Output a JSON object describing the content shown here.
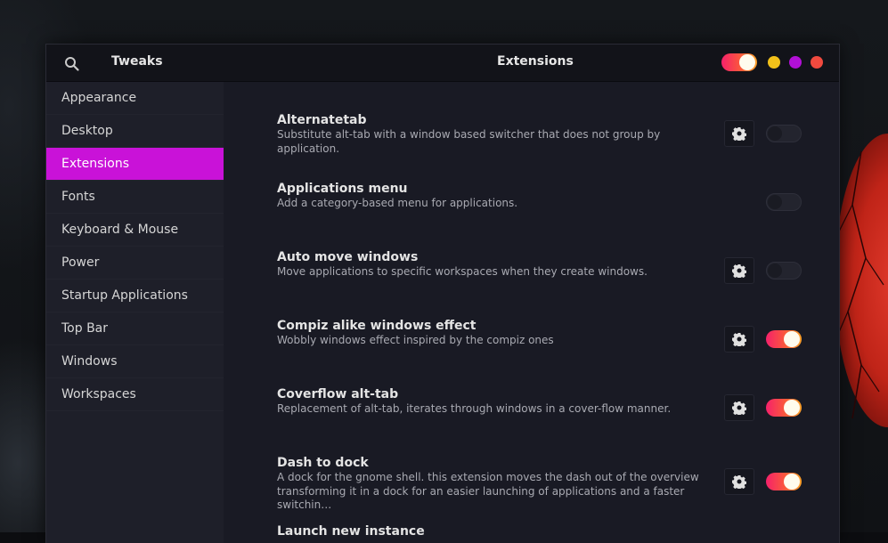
{
  "app": {
    "title": "Tweaks",
    "page_title": "Extensions"
  },
  "headerbar": {
    "search_icon": "search-icon",
    "window_controls": [
      {
        "name": "minimize",
        "color": "#f2c11a"
      },
      {
        "name": "maximize",
        "color": "#b210d6"
      },
      {
        "name": "close",
        "color": "#f14a3f"
      }
    ],
    "global_toggle": "on"
  },
  "sidebar": {
    "items": [
      {
        "label": "Appearance"
      },
      {
        "label": "Desktop"
      },
      {
        "label": "Extensions",
        "active": true
      },
      {
        "label": "Fonts"
      },
      {
        "label": "Keyboard & Mouse"
      },
      {
        "label": "Power"
      },
      {
        "label": "Startup Applications"
      },
      {
        "label": "Top Bar"
      },
      {
        "label": "Windows"
      },
      {
        "label": "Workspaces"
      }
    ]
  },
  "extensions": [
    {
      "name": "Alternatetab",
      "desc": "Substitute alt-tab with a window based switcher that does not group by application.",
      "has_settings": true,
      "enabled": false
    },
    {
      "name": "Applications menu",
      "desc": "Add a category-based menu for applications.",
      "has_settings": false,
      "enabled": false
    },
    {
      "name": "Auto move windows",
      "desc": "Move applications to specific workspaces when they create windows.",
      "has_settings": true,
      "enabled": false
    },
    {
      "name": "Compiz alike windows effect",
      "desc": "Wobbly windows effect inspired by the compiz ones",
      "has_settings": true,
      "enabled": true
    },
    {
      "name": "Coverflow alt-tab",
      "desc": "Replacement of alt-tab, iterates through windows in a cover-flow manner.",
      "has_settings": true,
      "enabled": true
    },
    {
      "name": "Dash to dock",
      "desc": "A dock for the gnome shell. this extension moves the dash out of the overview",
      "desc2": "transforming it in a dock for an easier launching of applications and a faster switchin…",
      "has_settings": true,
      "enabled": true
    },
    {
      "name": "Launch new instance",
      "desc": "",
      "has_settings": false,
      "enabled": false
    }
  ],
  "colors": {
    "accent": "#c912d8",
    "toggle_on_start": "#f5216b",
    "toggle_on_end": "#fca32a"
  }
}
